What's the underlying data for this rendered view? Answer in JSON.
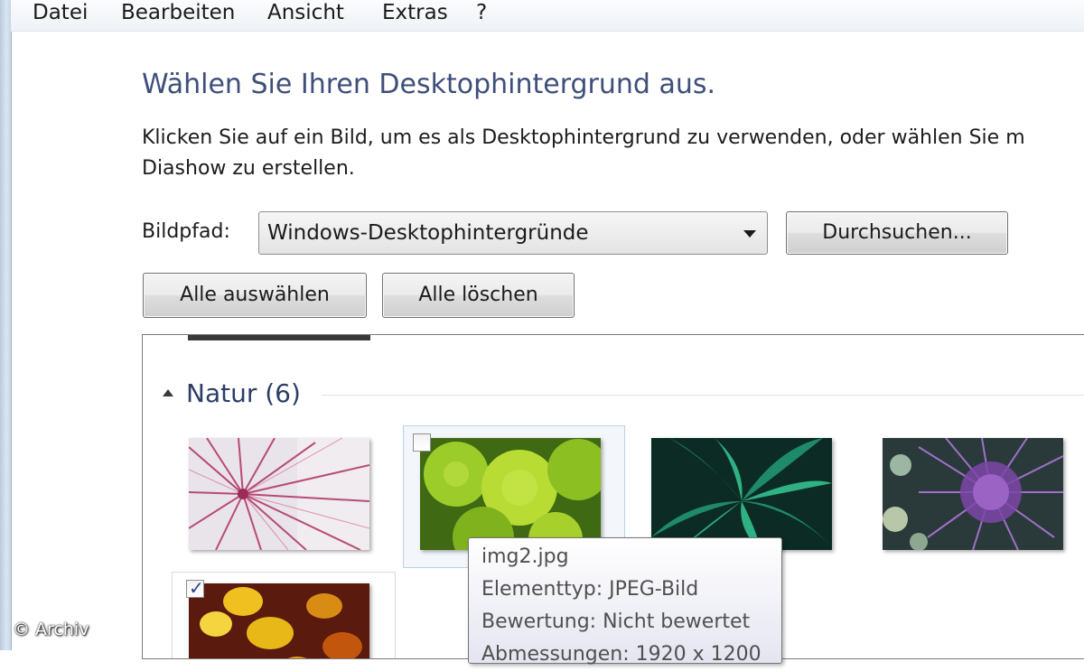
{
  "menu": {
    "items": [
      "Datei",
      "Bearbeiten",
      "Ansicht",
      "Extras",
      "?"
    ]
  },
  "page": {
    "title": "Wählen Sie Ihren Desktophintergrund aus.",
    "instruction_line1": "Klicken Sie auf ein Bild, um es als Desktophintergrund zu verwenden, oder wählen Sie m",
    "instruction_line2": "Diashow zu erstellen."
  },
  "picture_path": {
    "label": "Bildpfad:",
    "value": "Windows-Desktophintergründe",
    "browse_label": "Durchsuchen..."
  },
  "actions": {
    "select_all": "Alle auswählen",
    "clear_all": "Alle löschen"
  },
  "gallery": {
    "group_title": "Natur (6)",
    "thumbnails": [
      {
        "name": "thumb-1",
        "checked": false,
        "icon": "pink-radial-plant"
      },
      {
        "name": "thumb-2",
        "checked": false,
        "icon": "green-succulent"
      },
      {
        "name": "thumb-3",
        "checked": false,
        "icon": "teal-leaves"
      },
      {
        "name": "thumb-4",
        "checked": false,
        "icon": "purple-thistle"
      },
      {
        "name": "thumb-5",
        "checked": true,
        "icon": "autumn-leaves"
      }
    ]
  },
  "tooltip": {
    "filename": "img2.jpg",
    "type": "Elementtyp: JPEG-Bild",
    "rating": "Bewertung: Nicht bewertet",
    "dimensions": "Abmessungen: 1920 x 1200"
  },
  "watermark": "© Archiv",
  "colors": {
    "title": "#3f4f7a",
    "group_title": "#2c3e66",
    "checkbox_tick": "#24448a"
  }
}
